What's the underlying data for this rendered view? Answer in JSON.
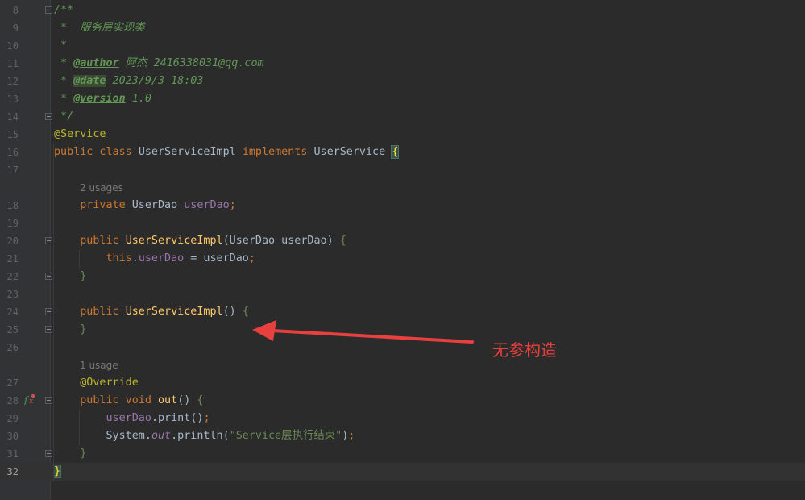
{
  "editor": {
    "lines": [
      {
        "num": "8",
        "html": "<span class=\"doc\">/**</span>"
      },
      {
        "num": "9",
        "html": "<span class=\"doc\"> *  服务层实现类</span>"
      },
      {
        "num": "10",
        "html": "<span class=\"doc\"> *</span>"
      },
      {
        "num": "11",
        "html": "<span class=\"doc\"> * </span><span class=\"doctag\">@author</span><span class=\"doc\"> 阿杰 2416338031@qq.com</span>"
      },
      {
        "num": "12",
        "html": "<span class=\"doc\"> * </span><span class=\"doctag hl\">@date</span><span class=\"doc\"> 2023/9/3 18:03</span>"
      },
      {
        "num": "13",
        "html": "<span class=\"doc\"> * </span><span class=\"doctag\">@version</span><span class=\"doc\"> 1.0</span>"
      },
      {
        "num": "14",
        "html": "<span class=\"doc\"> */</span>"
      },
      {
        "num": "15",
        "html": "<span class=\"ann\">@Service</span>"
      },
      {
        "num": "16",
        "html": "<span class=\"kw\">public class </span>UserServiceImpl <span class=\"kw\">implements </span>UserService <span class=\"brace match\">{</span>"
      },
      {
        "num": "17",
        "html": ""
      },
      {
        "num": "18",
        "html": "    <span class=\"kw\">private </span>UserDao <span class=\"field\">userDao</span><span class=\"kw\">;</span>"
      },
      {
        "num": "19",
        "html": ""
      },
      {
        "num": "20",
        "html": "    <span class=\"kw\">public </span><span class=\"fn\">UserServiceImpl</span>(UserDao userDao) <span class=\"str\">{</span>"
      },
      {
        "num": "21",
        "html": "        <span class=\"kw\">this</span>.<span class=\"field\">userDao</span> = userDao<span class=\"kw\">;</span>"
      },
      {
        "num": "22",
        "html": "    <span class=\"str\">}</span>"
      },
      {
        "num": "23",
        "html": ""
      },
      {
        "num": "24",
        "html": "    <span class=\"kw\">public </span><span class=\"fn\">UserServiceImpl</span>() <span class=\"str\">{</span>"
      },
      {
        "num": "25",
        "html": "    <span class=\"str\">}</span>"
      },
      {
        "num": "26",
        "html": ""
      },
      {
        "num": "27",
        "html": "    <span class=\"ann\">@Override</span>"
      },
      {
        "num": "28",
        "html": "    <span class=\"kw\">public void </span><span class=\"fn\">out</span>() <span class=\"str\">{</span>"
      },
      {
        "num": "29",
        "html": "        <span class=\"field\">userDao</span>.print()<span class=\"kw\">;</span>"
      },
      {
        "num": "30",
        "html": "        System.<span class=\"static\">out</span>.println(<span class=\"str\">\"Service层执行结束\"</span>)<span class=\"kw\">;</span>"
      },
      {
        "num": "31",
        "html": "    <span class=\"str\">}</span>"
      },
      {
        "num": "32",
        "html": "<span class=\"brace match\">}</span>"
      }
    ],
    "hints": [
      {
        "after": "17",
        "text": "2 usages"
      },
      {
        "after": "26",
        "text": "1 usage"
      }
    ],
    "current_line": "32"
  },
  "annotation": {
    "text": "无参构造",
    "color": "#e8403f"
  }
}
